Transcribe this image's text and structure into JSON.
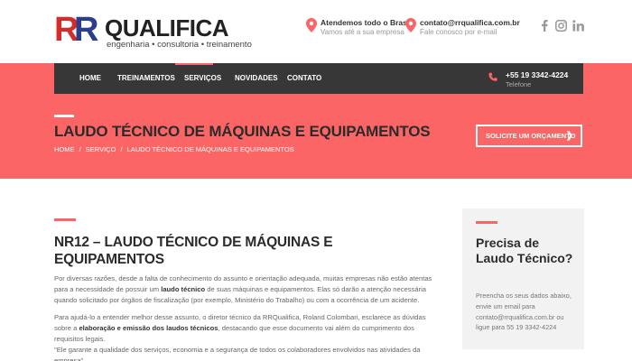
{
  "brand": {
    "mark_left": "R",
    "mark_right": "R",
    "name": "QUALIFICA",
    "tagline": "engenharia • consultoria • treinamento"
  },
  "contact_info": [
    {
      "title": "Atendemos todo o Brasil",
      "subtitle": "Vamos até a sua empresa"
    },
    {
      "title": "contato@rrqualifica.com.br",
      "subtitle": "Fale conosco por e-mail"
    }
  ],
  "social": [
    "facebook-icon",
    "instagram-icon",
    "linkedin-icon"
  ],
  "nav": {
    "items": [
      "HOME",
      "TREINAMENTOS",
      "SERVIÇOS",
      "NOVIDADES",
      "CONTATO"
    ],
    "active": "SERVIÇOS",
    "phone": "+55 19 3342-4224",
    "phone_label": "Telefone"
  },
  "hero": {
    "title": "LAUDO TÉCNICO DE MÁQUINAS E EQUIPAMENTOS",
    "breadcrumb": [
      "HOME",
      "/",
      "SERVIÇO",
      "/",
      "LAUDO TÉCNICO DE MÁQUINAS E EQUIPAMENTOS"
    ],
    "cta_label": "SOLICITE UM ORÇAMENTO"
  },
  "main": {
    "title": "NR12 – LAUDO TÉCNICO DE MÁQUINAS E EQUIPAMENTOS",
    "p1_a": "Por diversas razões, desde a falta de conhecimento do assunto e orientação adequada, muitas empresas não estão atentas para a necessidade de possuir um ",
    "p1_b": "laudo técnico",
    "p1_c": " de suas máquinas e equipamentos. Elas só darão a atenção necessária quando solicitado por órgãos de fiscalização (por exemplo, Ministério do Trabalho) ou com a ocorrência de um acidente.",
    "p2_a": "Para ajudá-lo a entender melhor desse assunto, o diretor técnico da RRQualifica, Roland Colombari, esclarece as dúvidas sobre a ",
    "p2_b": "elaboração e emissão dos laudos técnicos",
    "p2_c": ", destacando que esse documento vai além do cumprimento dos requisitos legais.",
    "p2_d": "\"Ele garante a qualidade dos serviços, economia e a segurança de todos os colaboradores envolvidos nas atividades da empresa\"."
  },
  "sidebar": {
    "title": "Precisa de Laudo Técnico?",
    "text": "Preencha os seus dados abaixo, envie um email para contato@rrqualifica.com.br ou ligue para 55 19 3342-4224"
  },
  "colors": {
    "accent": "#fb6565",
    "nav_bg": "#373737",
    "logo_red": "#d52b2b",
    "logo_blue": "#2b3d8f"
  }
}
